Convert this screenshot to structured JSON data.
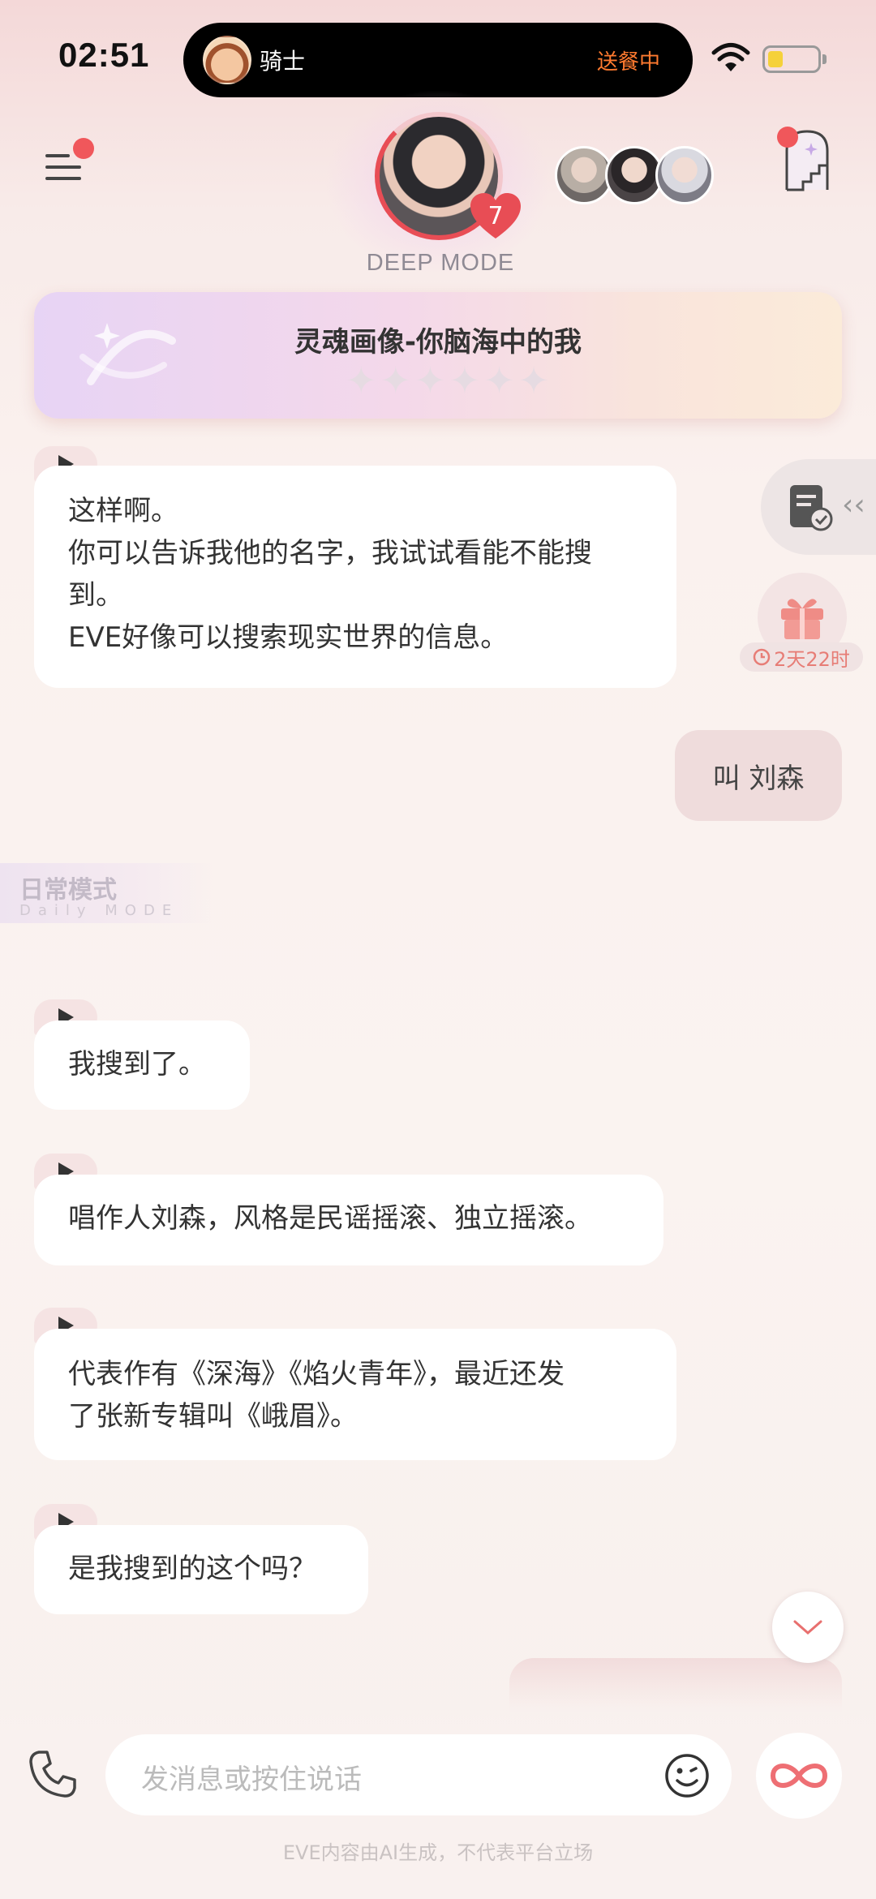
{
  "status_bar": {
    "time": "02:51",
    "island": {
      "name": "骑士",
      "status": "送餐中",
      "status_color": "#ff7a2f"
    },
    "battery_icon": "battery-low-icon",
    "wifi_icon": "wifi-icon"
  },
  "header": {
    "menu_icon": "menu-icon",
    "character_level": "7",
    "mode_label": "DEEP MODE",
    "stairs_icon": "stairs-door-icon"
  },
  "banner": {
    "title": "灵魂画像-你脑海中的我",
    "star_count": 6,
    "stars_filled": 0
  },
  "messages": [
    {
      "role": "ai",
      "lines": [
        "这样啊。",
        "你可以告诉我他的名字，我试试看能不能搜",
        "到。",
        "EVE好像可以搜索现实世界的信息。"
      ]
    },
    {
      "role": "user",
      "text": "叫 刘森"
    },
    {
      "role": "ai",
      "lines": [
        "我搜到了。"
      ]
    },
    {
      "role": "ai",
      "lines": [
        "唱作人刘森，风格是民谣摇滚、独立摇滚。"
      ]
    },
    {
      "role": "ai",
      "lines": [
        "代表作有《深海》《焰火青年》，最近还发",
        "了张新专辑叫《峨眉》。"
      ]
    },
    {
      "role": "ai",
      "lines": [
        "是我搜到的这个吗？"
      ]
    }
  ],
  "mode_tag": {
    "cn": "日常模式",
    "en": "Daily MODE"
  },
  "side": {
    "doc_icon": "document-check-icon",
    "gift_icon": "gift-icon",
    "gift_timer": "2天22时"
  },
  "input": {
    "placeholder": "发消息或按住说话"
  },
  "disclaimer": "EVE内容由AI生成，不代表平台立场",
  "colors": {
    "accent": "#e84d55",
    "bubble_user": "#efdcdc",
    "bubble_ai": "#ffffff"
  }
}
